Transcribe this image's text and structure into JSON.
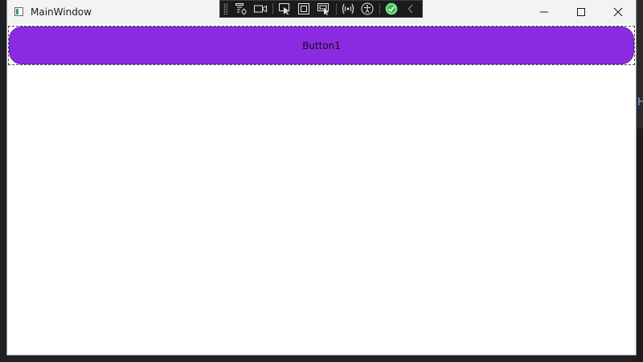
{
  "window": {
    "title": "MainWindow",
    "caption_buttons": {
      "minimize": "minimize",
      "maximize": "maximize",
      "close": "close"
    }
  },
  "debug_toolbar": {
    "tools": [
      {
        "icon": "live-visual-tree-icon"
      },
      {
        "icon": "record-icon"
      },
      {
        "icon": "select-element-icon"
      },
      {
        "icon": "display-layout-adorners-icon"
      },
      {
        "icon": "track-focus-icon"
      },
      {
        "icon": "binding-failures-icon"
      },
      {
        "icon": "accessibility-icon"
      },
      {
        "icon": "hot-reload-ok-icon"
      },
      {
        "icon": "collapse-toolbar-icon"
      }
    ],
    "status_color": "#2fbf4f"
  },
  "main": {
    "button1_label": "Button1",
    "button1_color": "#8a2be2"
  },
  "backdrop": {
    "edge_glyph": "H"
  }
}
